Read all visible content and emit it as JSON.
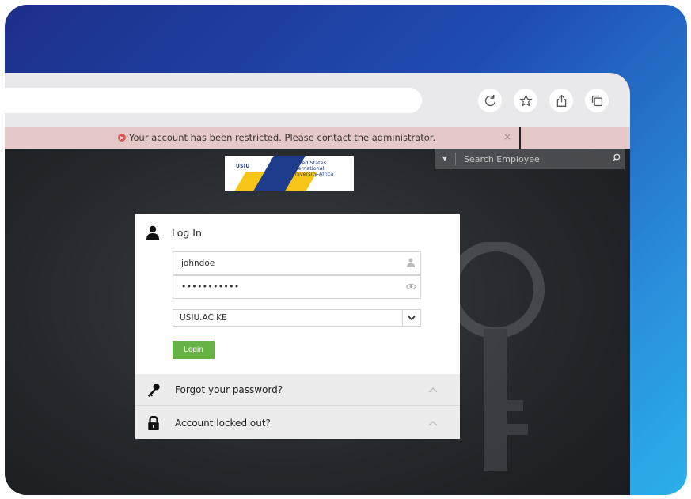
{
  "alert": {
    "message": "Your account has been restricted. Please contact the administrator.",
    "close": "×"
  },
  "search": {
    "placeholder": "Search Employee"
  },
  "logo": {
    "short": "USIU",
    "name": "United States International University-Africa"
  },
  "login": {
    "heading": "Log In",
    "username": "johndoe",
    "password_mask": "•••••••••••",
    "domain": "USIU.AC.KE",
    "submit_label": "Login"
  },
  "accordion": {
    "forgot_label": "Forgot your password?",
    "locked_label": "Account locked out?"
  },
  "icons": {
    "toolbar": [
      "reload-icon",
      "bookmark-star-icon",
      "share-icon",
      "tabs-icon"
    ],
    "user": "user-icon",
    "key": "key-icon",
    "lock": "lock-icon"
  },
  "colors": {
    "alert_bg": "#e5c9c9",
    "login_button": "#66b246",
    "background_gradient_start": "#1e2f8a",
    "background_gradient_end": "#2bb0ea"
  }
}
